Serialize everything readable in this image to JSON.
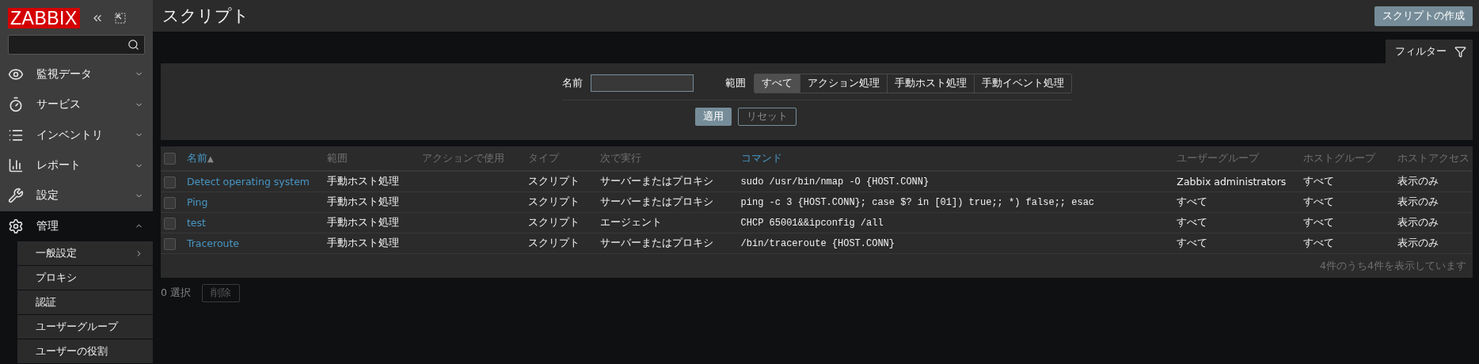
{
  "sidebar": {
    "logo": "ZABBIX",
    "menu": [
      {
        "label": "監視データ",
        "expanded": false
      },
      {
        "label": "サービス",
        "expanded": false
      },
      {
        "label": "インベントリ",
        "expanded": false
      },
      {
        "label": "レポート",
        "expanded": false
      },
      {
        "label": "設定",
        "expanded": false
      },
      {
        "label": "管理",
        "expanded": true,
        "children": [
          {
            "label": "一般設定",
            "submenu": true
          },
          {
            "label": "プロキシ",
            "submenu": false
          },
          {
            "label": "認証",
            "submenu": false
          },
          {
            "label": "ユーザーグループ",
            "submenu": false
          },
          {
            "label": "ユーザーの役割",
            "submenu": false
          }
        ]
      }
    ]
  },
  "header": {
    "title": "スクリプト",
    "create_button": "スクリプトの作成"
  },
  "filter": {
    "tab": "フィルター",
    "name_label": "名前",
    "scope_label": "範囲",
    "scopes": [
      {
        "label": "すべて",
        "selected": true
      },
      {
        "label": "アクション処理",
        "selected": false
      },
      {
        "label": "手動ホスト処理",
        "selected": false
      },
      {
        "label": "手動イベント処理",
        "selected": false
      }
    ],
    "apply": "適用",
    "reset": "リセット"
  },
  "table": {
    "columns": [
      {
        "label": "名前",
        "sortable": true,
        "sort": "▲"
      },
      {
        "label": "範囲",
        "sortable": false
      },
      {
        "label": "アクションで使用",
        "sortable": false
      },
      {
        "label": "タイプ",
        "sortable": false
      },
      {
        "label": "次で実行",
        "sortable": false
      },
      {
        "label": "コマンド",
        "sortable": true
      },
      {
        "label": "ユーザーグループ",
        "sortable": false
      },
      {
        "label": "ホストグループ",
        "sortable": false
      },
      {
        "label": "ホストアクセス",
        "sortable": false
      }
    ],
    "all_checked": false,
    "rows": [
      {
        "checked": false,
        "cells": [
          "Detect operating system",
          "手動ホスト処理",
          "",
          "スクリプト",
          "サーバーまたはプロキシ",
          "sudo /usr/bin/nmap -O {HOST.CONN}",
          "Zabbix administrators",
          "すべて",
          "表示のみ"
        ]
      },
      {
        "checked": false,
        "cells": [
          "Ping",
          "手動ホスト処理",
          "",
          "スクリプト",
          "サーバーまたはプロキシ",
          "ping -c 3 {HOST.CONN}; case $? in [01]) true;; *) false;; esac",
          "すべて",
          "すべて",
          "表示のみ"
        ]
      },
      {
        "checked": false,
        "cells": [
          "test",
          "手動ホスト処理",
          "",
          "スクリプト",
          "エージェント",
          "CHCP 65001&&ipconfig /all",
          "すべて",
          "すべて",
          "表示のみ"
        ]
      },
      {
        "checked": false,
        "cells": [
          "Traceroute",
          "手動ホスト処理",
          "",
          "スクリプト",
          "サーバーまたはプロキシ",
          "/bin/traceroute {HOST.CONN}",
          "すべて",
          "すべて",
          "表示のみ"
        ]
      }
    ],
    "summary": "4件のうち4件を表示しています"
  },
  "footer": {
    "selected": "0 選択",
    "delete_button": {
      "label": "削除",
      "disabled": true
    }
  }
}
